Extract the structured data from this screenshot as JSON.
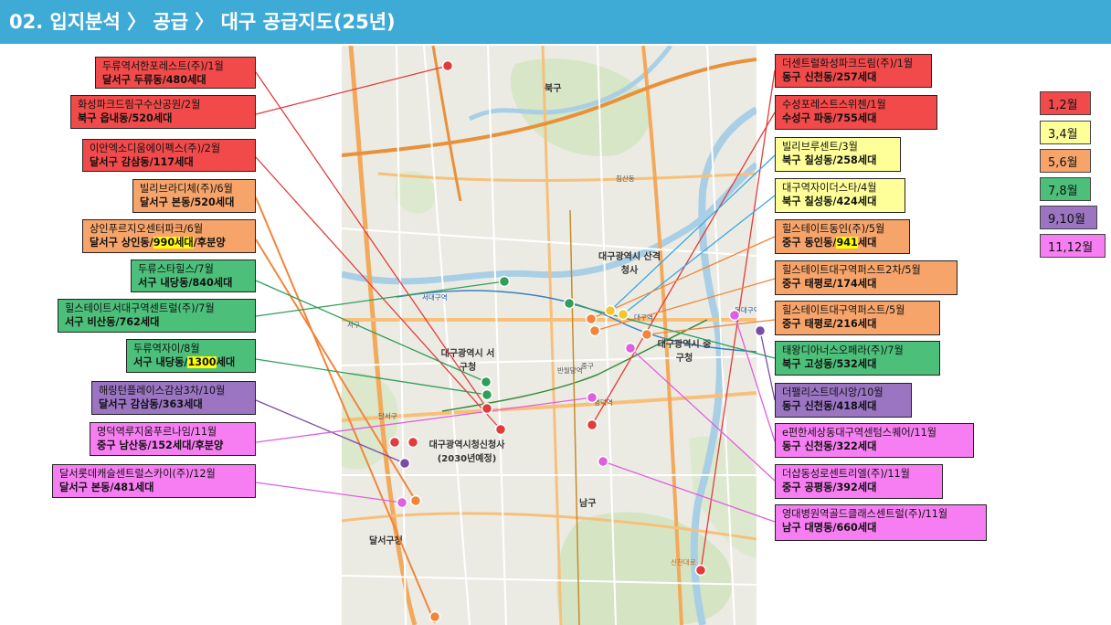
{
  "header": {
    "title": "02. 입지분석 〉 공급 〉 대구 공급지도(25년)"
  },
  "legend": [
    "1,2월",
    "3,4월",
    "5,6월",
    "7,8월",
    "9,10월",
    "11,12월"
  ],
  "colors": {
    "m12": "#f24a4a",
    "m34": "#ffff99",
    "m56": "#f7a46a",
    "m78": "#4cc07a",
    "m910": "#9b74c2",
    "m1112": "#f77ef2",
    "header": "#3eaad6"
  },
  "left_boxes": [
    {
      "name": "두류역서한포레스트(주)/1월",
      "detail": "달서구 두류동/480세대",
      "color": "c12"
    },
    {
      "name": "화성파크드림구수산공원/2월",
      "detail": "북구 읍내동/520세대",
      "color": "c12"
    },
    {
      "name": "이안엑소디움에이펙스(주)/2월",
      "detail": "달서구 감삼동/117세대",
      "color": "c12"
    },
    {
      "name": "빌리브라디체(주)/6월",
      "detail": "달서구 본동/520세대",
      "color": "c56"
    },
    {
      "name": "상인푸르지오센터파크/6월",
      "detail_pre": "달서구 상인동/",
      "detail_hl": "990세대",
      "detail_post": "/후분양",
      "color": "c56"
    },
    {
      "name": "두류스타힐스/7월",
      "detail": "서구 내당동/840세대",
      "color": "c78"
    },
    {
      "name": "힐스테이트서대구역센트럴(주)/7월",
      "detail": "서구 비산동/762세대",
      "color": "c78"
    },
    {
      "name": "두류역자이/8월",
      "detail_pre": "서구 내당동/",
      "detail_hl": "1300",
      "detail_post": "세대",
      "color": "c78"
    },
    {
      "name": "해링턴플레이스감삼3차/10월",
      "detail": "달서구 감삼동/363세대",
      "color": "c910"
    },
    {
      "name": "명덕역루지움푸르나임/11월",
      "detail": "중구 남산동/152세대/후분양",
      "color": "c1112"
    },
    {
      "name": "달서롯데캐슬센트럴스카이(주)/12월",
      "detail": "달서구 본동/481세대",
      "color": "c1112"
    }
  ],
  "right_boxes": [
    {
      "name": "더센트럴화성파크드림(주)/1월",
      "detail": "동구 신천동/257세대",
      "color": "c12"
    },
    {
      "name": "수성포레스트스위첸/1월",
      "detail": "수성구 파동/755세대",
      "color": "c12"
    },
    {
      "name": "빌리브루센트/3월",
      "detail": "북구 칠성동/258세대",
      "color": "c34"
    },
    {
      "name": "대구역자이더스타/4월",
      "detail": "북구 칠성동/424세대",
      "color": "c34"
    },
    {
      "name": "힐스테이트동인(주)/5월",
      "detail_pre": "중구 동인동/",
      "detail_hl": "941",
      "detail_post": "세대",
      "color": "c56"
    },
    {
      "name": "힐스테이트대구역퍼스트2차/5월",
      "detail": "중구 태평로/174세대",
      "color": "c56"
    },
    {
      "name": "힐스테이트대구역퍼스트/5월",
      "detail": "중구 태평로/216세대",
      "color": "c56"
    },
    {
      "name": "태왕디아너스오페라(주)/7월",
      "detail": "북구 고성동/532세대",
      "color": "c78"
    },
    {
      "name": "더팰리스트데시앙/10월",
      "detail": "동구 신천동/418세대",
      "color": "c910"
    },
    {
      "name": "e편한세상동대구역센텀스퀘어/11월",
      "detail": "동구 신천동/322세대",
      "color": "c1112"
    },
    {
      "name": "더샵동성로센트리엘(주)/11월",
      "detail": "중구 공평동/392세대",
      "color": "c1112"
    },
    {
      "name": "영대병원역골드클래스센트럴(주)/11월",
      "detail": "남구 대명동/660세대",
      "color": "c1112"
    }
  ],
  "map_labels": [
    "북구",
    "대구광역시 산격청사",
    "대구광역시 서구청",
    "대구광역시 중구청",
    "대구광역시청신청사 (2030년예정)",
    "남구",
    "달서구청",
    "서대구역",
    "대구역",
    "동대구역",
    "반월당역",
    "명덕역",
    "침산동",
    "신천대로",
    "달서구",
    "중구",
    "서구"
  ]
}
